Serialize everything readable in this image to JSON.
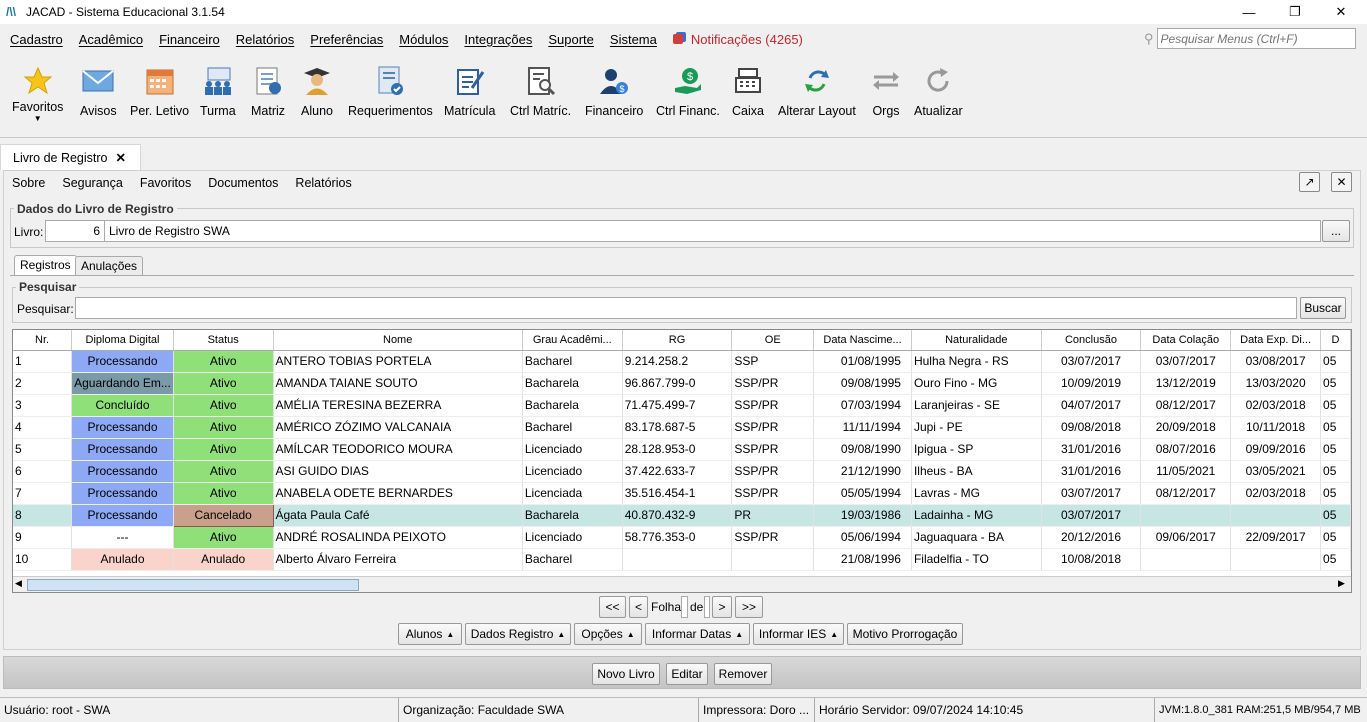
{
  "app": {
    "title": "JACAD - Sistema Educacional 3.1.54"
  },
  "menu": {
    "items": [
      "Cadastro",
      "Acadêmico",
      "Financeiro",
      "Relatórios",
      "Preferências",
      "Módulos",
      "Integrações",
      "Suporte",
      "Sistema"
    ],
    "notifications": "Notificações (4265)",
    "search_placeholder": "Pesquisar Menus (Ctrl+F)"
  },
  "toolbar": {
    "favoritos": "Favoritos",
    "avisos": "Avisos",
    "per_letivo": "Per. Letivo",
    "turma": "Turma",
    "matriz": "Matriz",
    "aluno": "Aluno",
    "requerimentos": "Requerimentos",
    "matricula": "Matrícula",
    "ctrl_matric": "Ctrl Matríc.",
    "financeiro": "Financeiro",
    "ctrl_financ": "Ctrl Financ.",
    "caixa": "Caixa",
    "alterar_layout": "Alterar Layout",
    "orgs": "Orgs",
    "atualizar": "Atualizar"
  },
  "doc_tab": {
    "label": "Livro de Registro",
    "close": "✕"
  },
  "submenu": {
    "items": [
      "Sobre",
      "Segurança",
      "Favoritos",
      "Documentos",
      "Relatórios"
    ]
  },
  "livro_box": {
    "legend": "Dados do Livro de Registro",
    "livro_label": "Livro:",
    "livro_number": "6",
    "livro_name": "Livro de Registro SWA",
    "browse": "..."
  },
  "tabs": {
    "registros": "Registros",
    "anulacoes": "Anulações"
  },
  "search": {
    "legend": "Pesquisar",
    "label": "Pesquisar:",
    "value": "",
    "button": "Buscar"
  },
  "colors": {
    "processando": "#8da9f5",
    "aguardando": "#7a9aa8",
    "concluido": "#90e07a",
    "ativo": "#90e07a",
    "cancelado": "#c8a08c",
    "anulado": "#fad3ca",
    "selected_row": "#c6e6e4"
  },
  "grid": {
    "columns": [
      "Nr.",
      "Diploma Digital",
      "Status",
      "Nome",
      "Grau Acadêmi...",
      "RG",
      "OE",
      "Data Nascime...",
      "Naturalidade",
      "Conclusão",
      "Data Colação",
      "Data Exp. Di...",
      "D"
    ],
    "rows": [
      {
        "nr": "1",
        "diploma": "Processando",
        "diploma_style": "processando",
        "status": "Ativo",
        "status_style": "ativo",
        "nome": "ANTERO TOBIAS PORTELA",
        "grau": "Bacharel",
        "rg": "9.214.258.2",
        "oe": "SSP",
        "nasc": "01/08/1995",
        "nat": "Hulha Negra - RS",
        "conclusao": "03/07/2017",
        "colacao": "03/07/2017",
        "exp": "03/08/2017",
        "d": "05"
      },
      {
        "nr": "2",
        "diploma": "Aguardando Em...",
        "diploma_style": "aguardando",
        "status": "Ativo",
        "status_style": "ativo",
        "nome": "AMANDA TAIANE SOUTO",
        "grau": "Bacharela",
        "rg": "96.867.799-0",
        "oe": "SSP/PR",
        "nasc": "09/08/1995",
        "nat": "Ouro Fino - MG",
        "conclusao": "10/09/2019",
        "colacao": "13/12/2019",
        "exp": "13/03/2020",
        "d": "05"
      },
      {
        "nr": "3",
        "diploma": "Concluído",
        "diploma_style": "concluido",
        "status": "Ativo",
        "status_style": "ativo",
        "nome": "AMÉLIA TERESINA BEZERRA",
        "grau": "Bacharela",
        "rg": "71.475.499-7",
        "oe": "SSP/PR",
        "nasc": "07/03/1994",
        "nat": "Laranjeiras - SE",
        "conclusao": "04/07/2017",
        "colacao": "08/12/2017",
        "exp": "02/03/2018",
        "d": "05"
      },
      {
        "nr": "4",
        "diploma": "Processando",
        "diploma_style": "processando",
        "status": "Ativo",
        "status_style": "ativo",
        "nome": "AMÉRICO ZÓZIMO VALCANAIA",
        "grau": "Bacharel",
        "rg": "83.178.687-5",
        "oe": "SSP/PR",
        "nasc": "11/11/1994",
        "nat": "Jupi - PE",
        "conclusao": "09/08/2018",
        "colacao": "20/09/2018",
        "exp": "10/11/2018",
        "d": "05"
      },
      {
        "nr": "5",
        "diploma": "Processando",
        "diploma_style": "processando",
        "status": "Ativo",
        "status_style": "ativo",
        "nome": "AMÍLCAR TEODORICO MOURA",
        "grau": "Licenciado",
        "rg": "28.128.953-0",
        "oe": "SSP/PR",
        "nasc": "09/08/1990",
        "nat": "Ipigua - SP",
        "conclusao": "31/01/2016",
        "colacao": "08/07/2016",
        "exp": "09/09/2016",
        "d": "05"
      },
      {
        "nr": "6",
        "diploma": "Processando",
        "diploma_style": "processando",
        "status": "Ativo",
        "status_style": "ativo",
        "nome": "ASI GUIDO DIAS",
        "grau": "Licenciado",
        "rg": "37.422.633-7",
        "oe": "SSP/PR",
        "nasc": "21/12/1990",
        "nat": "Ilheus - BA",
        "conclusao": "31/01/2016",
        "colacao": "11/05/2021",
        "exp": "03/05/2021",
        "d": "05"
      },
      {
        "nr": "7",
        "diploma": "Processando",
        "diploma_style": "processando",
        "status": "Ativo",
        "status_style": "ativo",
        "nome": "ANABELA ODETE BERNARDES",
        "grau": "Licenciada",
        "rg": "35.516.454-1",
        "oe": "SSP/PR",
        "nasc": "05/05/1994",
        "nat": "Lavras - MG",
        "conclusao": "03/07/2017",
        "colacao": "08/12/2017",
        "exp": "02/03/2018",
        "d": "05"
      },
      {
        "nr": "8",
        "diploma": "Processando",
        "diploma_style": "processando",
        "status": "Cancelado",
        "status_style": "cancelado",
        "nome": "Ágata Paula Café",
        "grau": "Bacharela",
        "rg": "40.870.432-9",
        "oe": "PR",
        "nasc": "19/03/1986",
        "nat": "Ladainha - MG",
        "conclusao": "03/07/2017",
        "colacao": "",
        "exp": "",
        "d": "05",
        "selected": true
      },
      {
        "nr": "9",
        "diploma": "---",
        "diploma_style": "none",
        "status": "Ativo",
        "status_style": "ativo",
        "nome": "ANDRÉ ROSALINDA PEIXOTO",
        "grau": "Licenciado",
        "rg": "58.776.353-0",
        "oe": "SSP/PR",
        "nasc": "05/06/1994",
        "nat": "Jaguaquara - BA",
        "conclusao": "20/12/2016",
        "colacao": "09/06/2017",
        "exp": "22/09/2017",
        "d": "05"
      },
      {
        "nr": "10",
        "diploma": "Anulado",
        "diploma_style": "anulado",
        "status": "Anulado",
        "status_style": "anulado",
        "nome": "Alberto Álvaro Ferreira",
        "grau": "Bacharel",
        "rg": "",
        "oe": "",
        "nasc": "21/08/1996",
        "nat": "Filadelfia - TO",
        "conclusao": "10/08/2018",
        "colacao": "",
        "exp": "",
        "d": "05"
      }
    ]
  },
  "pager": {
    "first": "<<",
    "prev": "<",
    "folha": "Folha",
    "de": "de",
    "next": ">",
    "last": ">>"
  },
  "actions": {
    "alunos": "Alunos",
    "dados_registro": "Dados Registro",
    "opcoes": "Opções",
    "informar_datas": "Informar Datas",
    "informar_ies": "Informar IES",
    "motivo": "Motivo Prorrogação"
  },
  "footer": {
    "novo": "Novo Livro",
    "editar": "Editar",
    "remover": "Remover"
  },
  "status": {
    "usuario": "Usuário: root - SWA",
    "organizacao": "Organização: Faculdade SWA",
    "impressora": "Impressora: Doro ...",
    "horario": "Horário Servidor: 09/07/2024 14:10:45",
    "jvm": "JVM:1.8.0_381  RAM:251,5 MB/954,7 MB"
  }
}
